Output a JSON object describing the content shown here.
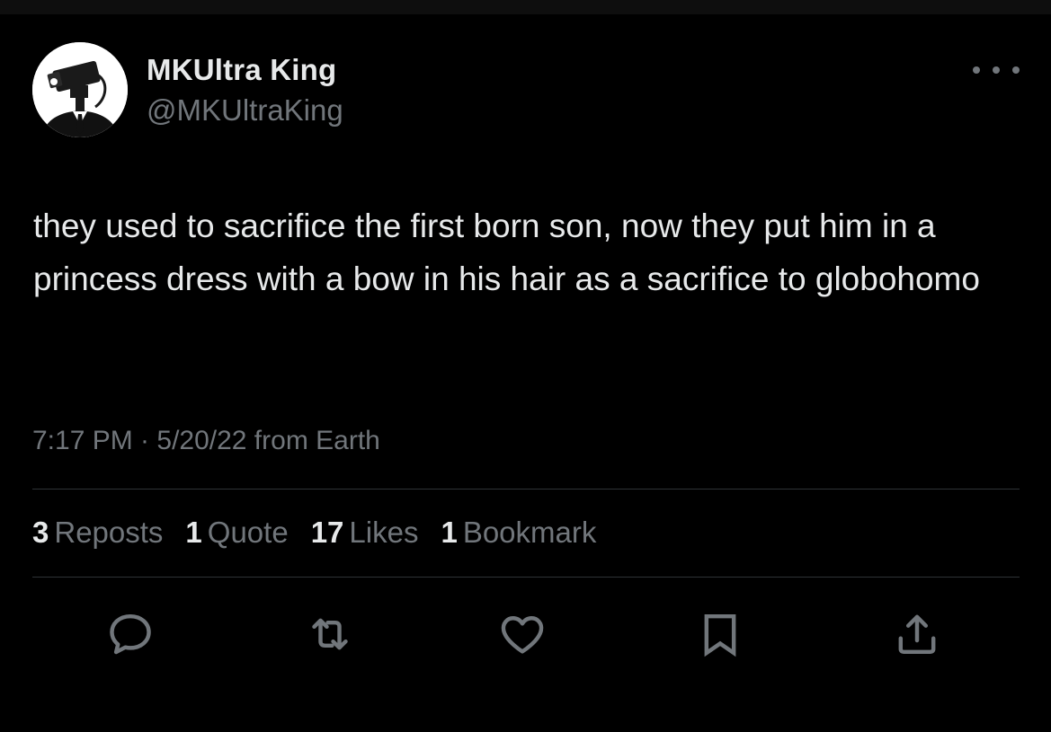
{
  "author": {
    "display_name": "MKUltra King",
    "handle": "@MKUltraKing",
    "avatar_icon": "avatar-camera-head-suit"
  },
  "tweet": {
    "text": "they used to sacrifice the first born son, now they put him in a princess dress with a bow in his hair as a sacrifice to globohomo",
    "meta": "7:17 PM · 5/20/22 from Earth"
  },
  "stats": {
    "reposts_count": "3",
    "reposts_label": "Reposts",
    "quotes_count": "1",
    "quotes_label": "Quote",
    "likes_count": "17",
    "likes_label": "Likes",
    "bookmarks_count": "1",
    "bookmarks_label": "Bookmark"
  },
  "actions": [
    "reply-icon",
    "repost-icon",
    "like-icon",
    "bookmark-icon",
    "share-icon"
  ],
  "colors": {
    "background": "#000000",
    "primary_text": "#e7e9ea",
    "secondary_text": "#71767b",
    "divider": "#2f3336"
  }
}
